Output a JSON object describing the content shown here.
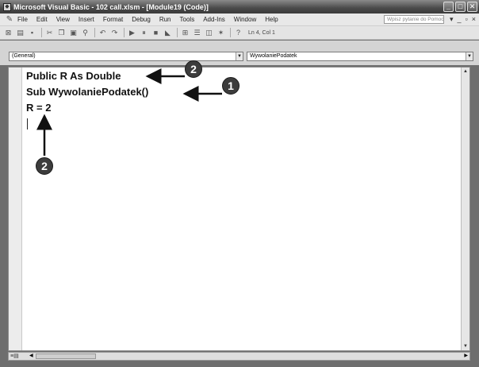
{
  "window": {
    "title": "Microsoft Visual Basic - 102 call.xlsm - [Module19 (Code)]",
    "buttons": [
      "_",
      "□",
      "✕"
    ]
  },
  "menubar": {
    "items": [
      "File",
      "Edit",
      "View",
      "Insert",
      "Format",
      "Debug",
      "Run",
      "Tools",
      "Add-Ins",
      "Window",
      "Help"
    ],
    "help_placeholder": "Wpisz pytanie do Pomocy",
    "mdi_buttons": [
      "▾",
      "_",
      "▫",
      "×"
    ]
  },
  "toolbar": {
    "icons": [
      "view-excel-icon",
      "insert-module-icon",
      "save-icon",
      "cut-icon",
      "copy-icon",
      "paste-icon",
      "find-icon",
      "undo-icon",
      "redo-icon",
      "run-icon",
      "break-icon",
      "reset-icon",
      "design-mode-icon",
      "project-explorer-icon",
      "properties-icon",
      "object-browser-icon",
      "toolbox-icon",
      "help-icon"
    ],
    "cursor_position": "Ln 4, Col 1"
  },
  "combos": {
    "object": "(General)",
    "procedure": "WywolaniePodatek"
  },
  "code": {
    "lines": [
      "Public R As Double",
      "Sub WywolaniePodatek()",
      "R = 2"
    ]
  },
  "callouts": [
    {
      "number": "2",
      "target": "public-declaration"
    },
    {
      "number": "1",
      "target": "sub-declaration"
    },
    {
      "number": "2",
      "target": "cursor-line"
    }
  ]
}
